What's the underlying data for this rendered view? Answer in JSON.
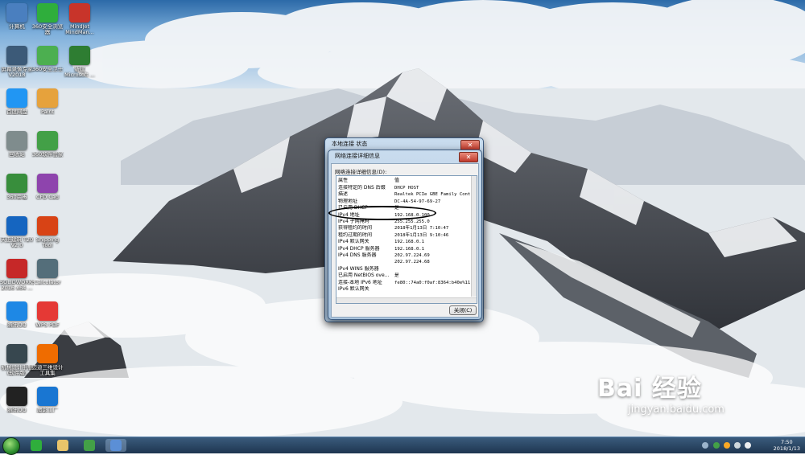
{
  "desktop": {
    "icons": [
      {
        "label": "计算机",
        "color": "#4a7fbf"
      },
      {
        "label": "360安全浏览器",
        "color": "#2fae3c"
      },
      {
        "label": "MindJet MindMan...",
        "color": "#c8342a"
      },
      {
        "label": "屏幕录像专家 V2018",
        "color": "#3c5a78"
      },
      {
        "label": "360安全卫士",
        "color": "#4caf50"
      },
      {
        "label": "新建 Microsoft ...",
        "color": "#2e7d32"
      },
      {
        "label": "百度网盘",
        "color": "#2196f3"
      },
      {
        "label": "Paint",
        "color": "#e6a23c"
      },
      {
        "label": "回收站",
        "color": "#7f8c8d"
      },
      {
        "label": "360软件管家",
        "color": "#43a047"
      },
      {
        "label": "360杀毒",
        "color": "#388e3c"
      },
      {
        "label": "CFD Cad",
        "color": "#8e44ad"
      },
      {
        "label": "天正建筑 T20 V2.0",
        "color": "#1565c0"
      },
      {
        "label": "Snipping Tool",
        "color": "#d84315"
      },
      {
        "label": "SOLIDWORKS 2016 x64 ...",
        "color": "#c62828"
      },
      {
        "label": "Calculator",
        "color": "#546e7a"
      },
      {
        "label": "腾讯QQ",
        "color": "#1e88e5"
      },
      {
        "label": "WPS PDF",
        "color": "#e53935"
      },
      {
        "label": "机械设计手册 (软件版)",
        "color": "#37474f"
      },
      {
        "label": "迈迪三维设计工具集",
        "color": "#ef6c00"
      },
      {
        "label": "腾讯QQ",
        "color": "#222222"
      },
      {
        "label": "魔影工厂",
        "color": "#1976d2"
      }
    ]
  },
  "status_window": {
    "title": "本地连接 状态"
  },
  "details_dialog": {
    "title": "网络连接详细信息",
    "group_label": "网络连接详细信息(D):",
    "col_property": "属性",
    "col_value": "值",
    "rows": [
      {
        "k": "连接特定的 DNS 后缀",
        "v": "DHCP HOST"
      },
      {
        "k": "描述",
        "v": "Realtek PCIe GBE Family Contro"
      },
      {
        "k": "物理地址",
        "v": "DC-4A-54-97-69-27"
      },
      {
        "k": "已启用 DHCP",
        "v": "是"
      },
      {
        "k": "IPv4 地址",
        "v": "192.168.0.100"
      },
      {
        "k": "IPv4 子网掩码",
        "v": "255.255.255.0"
      },
      {
        "k": "获得租约的时间",
        "v": "2018年1月13日 7:10:47"
      },
      {
        "k": "租约过期的时间",
        "v": "2018年1月13日 9:10:46"
      },
      {
        "k": "IPv4 默认网关",
        "v": "192.168.0.1"
      },
      {
        "k": "IPv4 DHCP 服务器",
        "v": "192.168.0.1"
      },
      {
        "k": "IPv4 DNS 服务器",
        "v": "202.97.224.69"
      },
      {
        "k": "",
        "v": "202.97.224.68"
      },
      {
        "k": "IPv4 WINS 服务器",
        "v": ""
      },
      {
        "k": "已启用 NetBIOS ove...",
        "v": "是"
      },
      {
        "k": "连接-本地 IPv6 地址",
        "v": "fe80::74a0:f0af:8364:b40e%11"
      },
      {
        "k": "IPv6 默认网关",
        "v": ""
      }
    ],
    "close_button": "关闭(C)",
    "highlight_color": "#000000"
  },
  "taskbar": {
    "apps": [
      {
        "name": "360-browser-icon",
        "color": "#2fae3c"
      },
      {
        "name": "file-explorer-icon",
        "color": "#e9c46a"
      },
      {
        "name": "ie-browser-icon",
        "color": "#43a047"
      },
      {
        "name": "network-status-icon",
        "color": "#5b8fd6"
      }
    ],
    "clock_time": "7:50",
    "clock_date": "2018/1/13"
  },
  "watermark": {
    "brand": "Bai 经验",
    "url": "jingyan.baidu.com"
  }
}
